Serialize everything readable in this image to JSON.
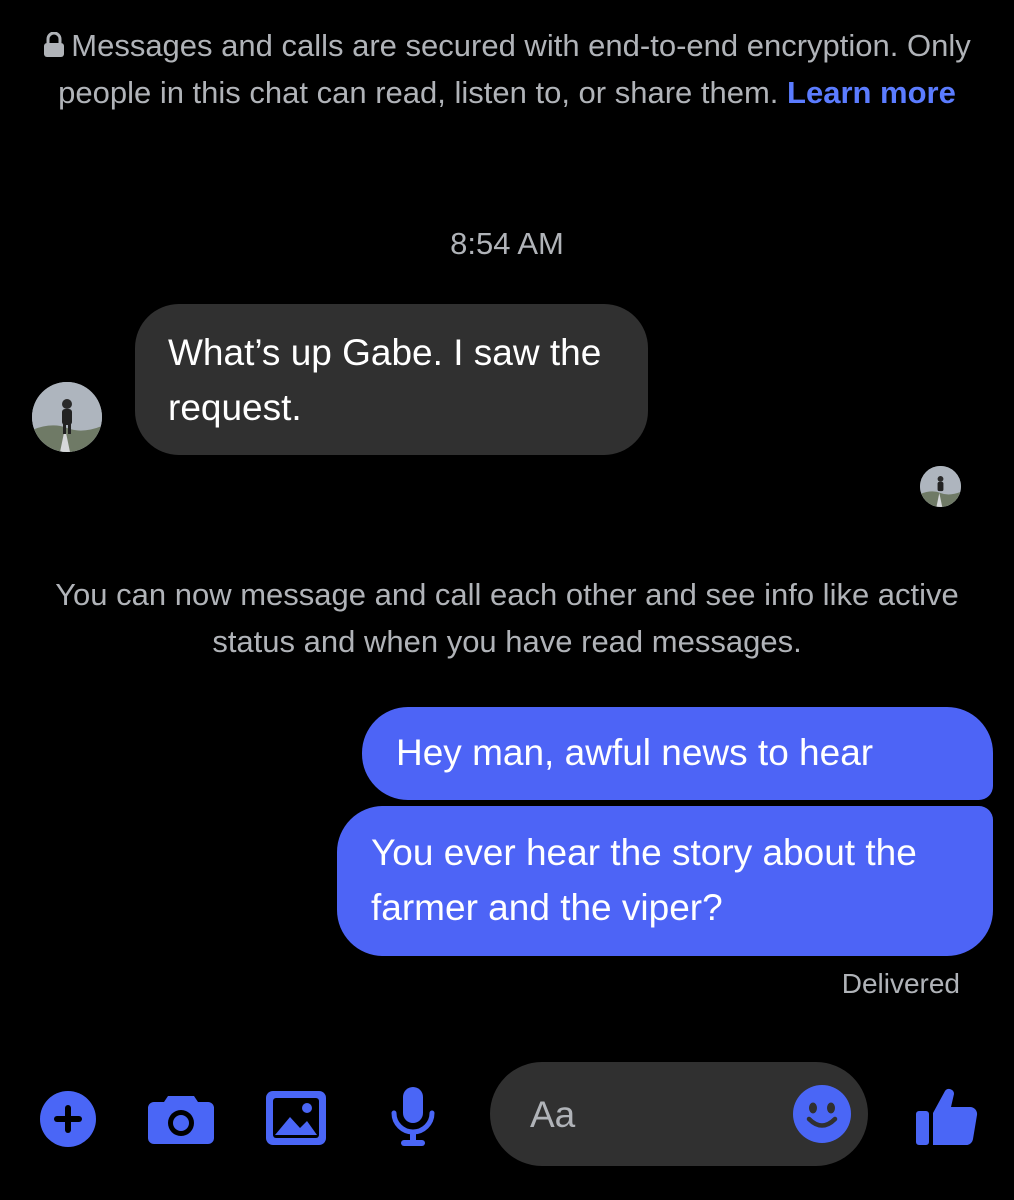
{
  "banner": {
    "lock_icon": "lock-icon",
    "text": "Messages and calls are secured with end-to-end encryption. Only people in this chat can read, listen to, or share them.",
    "link_label": "Learn more"
  },
  "timestamp": "8:54 AM",
  "messages": [
    {
      "direction": "incoming",
      "text": "What’s up Gabe. I saw the request."
    },
    {
      "direction": "outgoing",
      "text": "Hey man, awful news to hear"
    },
    {
      "direction": "outgoing",
      "text": "You ever hear the story about the farmer and the viper?"
    }
  ],
  "system_notice": "You can now message and call each other and see info like active status and when you have read messages.",
  "delivery_status": "Delivered",
  "composer": {
    "placeholder": "Aa",
    "actions": [
      "plus-icon",
      "camera-icon",
      "photo-icon",
      "microphone-icon"
    ],
    "emoji_icon": "smiley-icon",
    "send_icon": "thumbs-up-icon"
  },
  "colors": {
    "background": "#000000",
    "accent": "#4d64f6",
    "icon_accent": "#4a66f6",
    "link": "#5b7cff",
    "incoming_bubble": "#303030",
    "muted_text": "#b0b3b8"
  }
}
